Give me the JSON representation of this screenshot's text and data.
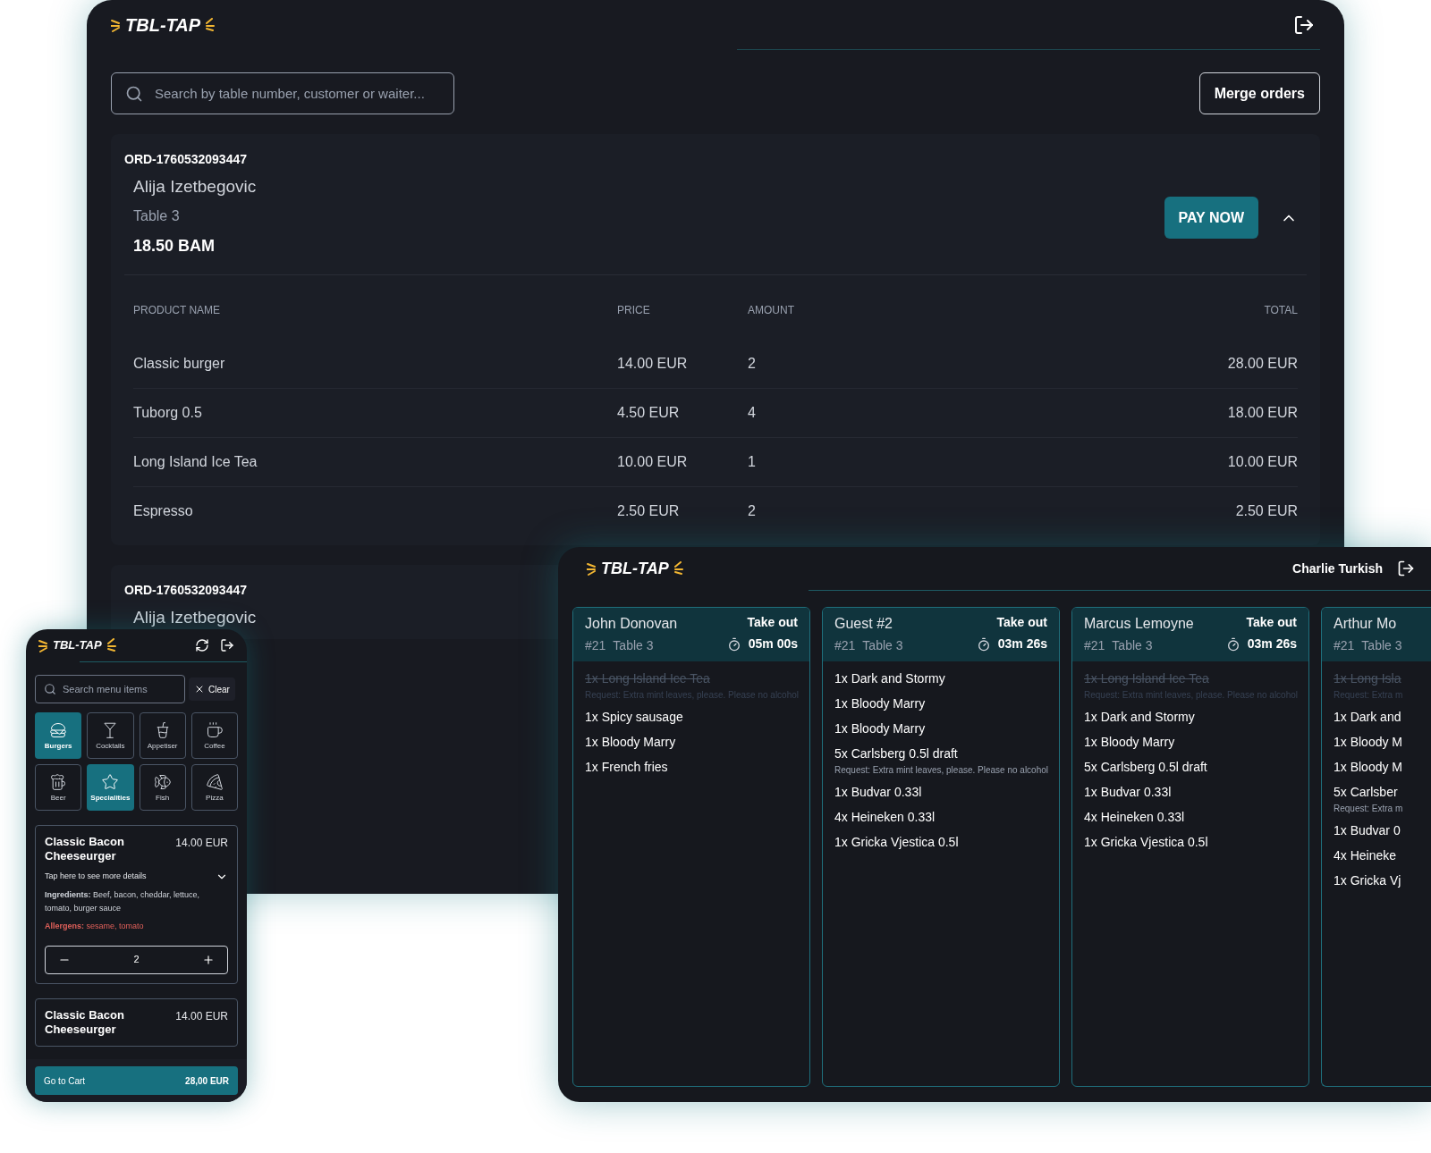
{
  "admin": {
    "logo": "TBL-TAP",
    "search": {
      "placeholder": "Search by table number, customer or waiter..."
    },
    "merge_button": "Merge orders",
    "orders": [
      {
        "id": "ORD-1760532093447",
        "customer": "Alija Izetbegovic",
        "table": "Table 3",
        "total": "18.50 BAM",
        "pay_button": "PAY NOW",
        "expanded": true,
        "columns": [
          "PRODUCT NAME",
          "PRICE",
          "AMOUNT",
          "TOTAL"
        ],
        "rows": [
          {
            "product": "Classic burger",
            "price": "14.00 EUR",
            "amount": "2",
            "total": "28.00 EUR"
          },
          {
            "product": "Tuborg 0.5",
            "price": "4.50 EUR",
            "amount": "4",
            "total": "18.00 EUR"
          },
          {
            "product": "Long Island Ice Tea",
            "price": "10.00 EUR",
            "amount": "1",
            "total": "10.00 EUR"
          },
          {
            "product": "Espresso",
            "price": "2.50 EUR",
            "amount": "2",
            "total": "2.50 EUR"
          }
        ]
      },
      {
        "id": "ORD-1760532093447",
        "customer": "Alija Izetbegovic"
      }
    ]
  },
  "kitchen": {
    "logo": "TBL-TAP",
    "user": "Charlie Turkish",
    "tickets": [
      {
        "customer": "John Donovan",
        "number": "#21",
        "table": "Table 3",
        "type": "Take out",
        "timer": "05m 00s",
        "items": [
          {
            "text": "1x Long Island Ice Tea",
            "done": true,
            "request": "Request: Extra mint leaves, please. Please no alcohol"
          },
          {
            "text": "1x Spicy sausage",
            "done": false
          },
          {
            "text": "1x Bloody Marry",
            "done": false
          },
          {
            "text": "1x French fries",
            "done": false
          }
        ]
      },
      {
        "customer": "Guest #2",
        "number": "#21",
        "table": "Table 3",
        "type": "Take out",
        "timer": "03m 26s",
        "items": [
          {
            "text": "1x Dark and Stormy",
            "done": false
          },
          {
            "text": "1x Bloody Marry",
            "done": false
          },
          {
            "text": "1x Bloody Marry",
            "done": false
          },
          {
            "text": "5x Carlsberg 0.5l draft",
            "done": false,
            "request": "Request: Extra mint leaves, please. Please no alcohol"
          },
          {
            "text": "1x Budvar 0.33l",
            "done": false
          },
          {
            "text": "4x Heineken 0.33l",
            "done": false
          },
          {
            "text": "1x Gricka Vjestica 0.5l",
            "done": false
          }
        ]
      },
      {
        "customer": "Marcus Lemoyne",
        "number": "#21",
        "table": "Table 3",
        "type": "Take out",
        "timer": "03m 26s",
        "items": [
          {
            "text": "1x Long Island Ice Tea",
            "done": true,
            "request": "Request: Extra mint leaves, please. Please no alcohol"
          },
          {
            "text": "1x Dark and Stormy",
            "done": false
          },
          {
            "text": "1x Bloody Marry",
            "done": false
          },
          {
            "text": "5x Carlsberg 0.5l draft",
            "done": false
          },
          {
            "text": "1x Budvar 0.33l",
            "done": false
          },
          {
            "text": "4x Heineken 0.33l",
            "done": false
          },
          {
            "text": "1x Gricka Vjestica 0.5l",
            "done": false
          }
        ]
      },
      {
        "customer": "Arthur Mo",
        "number": "#21",
        "table": "Table 3",
        "items": [
          {
            "text": "1x Long Isla",
            "done": true,
            "request": "Request: Extra m"
          },
          {
            "text": "1x Dark and",
            "done": false
          },
          {
            "text": "1x Bloody M",
            "done": false
          },
          {
            "text": "1x Bloody M",
            "done": false
          },
          {
            "text": "5x Carlsber",
            "done": false,
            "request": "Request: Extra m"
          },
          {
            "text": "1x Budvar 0",
            "done": false
          },
          {
            "text": "4x Heineke",
            "done": false
          },
          {
            "text": "1x Gricka Vj",
            "done": false
          }
        ]
      }
    ]
  },
  "phone": {
    "logo": "TBL-TAP",
    "search": {
      "placeholder": "Search menu items"
    },
    "clear_button": "Clear",
    "categories": [
      {
        "label": "Burgers",
        "kind": "burger",
        "selected": true
      },
      {
        "label": "Cocktails",
        "kind": "cocktail",
        "selected": false
      },
      {
        "label": "Appetiser",
        "kind": "drink",
        "selected": false
      },
      {
        "label": "Coffee",
        "kind": "coffee",
        "selected": false
      },
      {
        "label": "Beer",
        "kind": "beer",
        "selected": false
      },
      {
        "label": "Specialities",
        "kind": "star",
        "selected": true
      },
      {
        "label": "Fish",
        "kind": "fish",
        "selected": false
      },
      {
        "label": "Pizza",
        "kind": "pizza",
        "selected": false
      }
    ],
    "products": [
      {
        "name": "Classic Bacon Cheeseurger",
        "price": "14.00 EUR",
        "expanded": true,
        "details_toggle": "Tap here to see more details",
        "ingredients": "**Ingredients:** Beef, bacon, cheddar, lettuce, tomato, burger sauce",
        "allergens": "**Allergens:** sesame, tomato",
        "quantity": "2"
      },
      {
        "name": "Classic Bacon Cheeseurger",
        "price": "14.00 EUR"
      }
    ],
    "cart_button": {
      "label": "Go to Cart",
      "total": "28,00 EUR"
    }
  }
}
